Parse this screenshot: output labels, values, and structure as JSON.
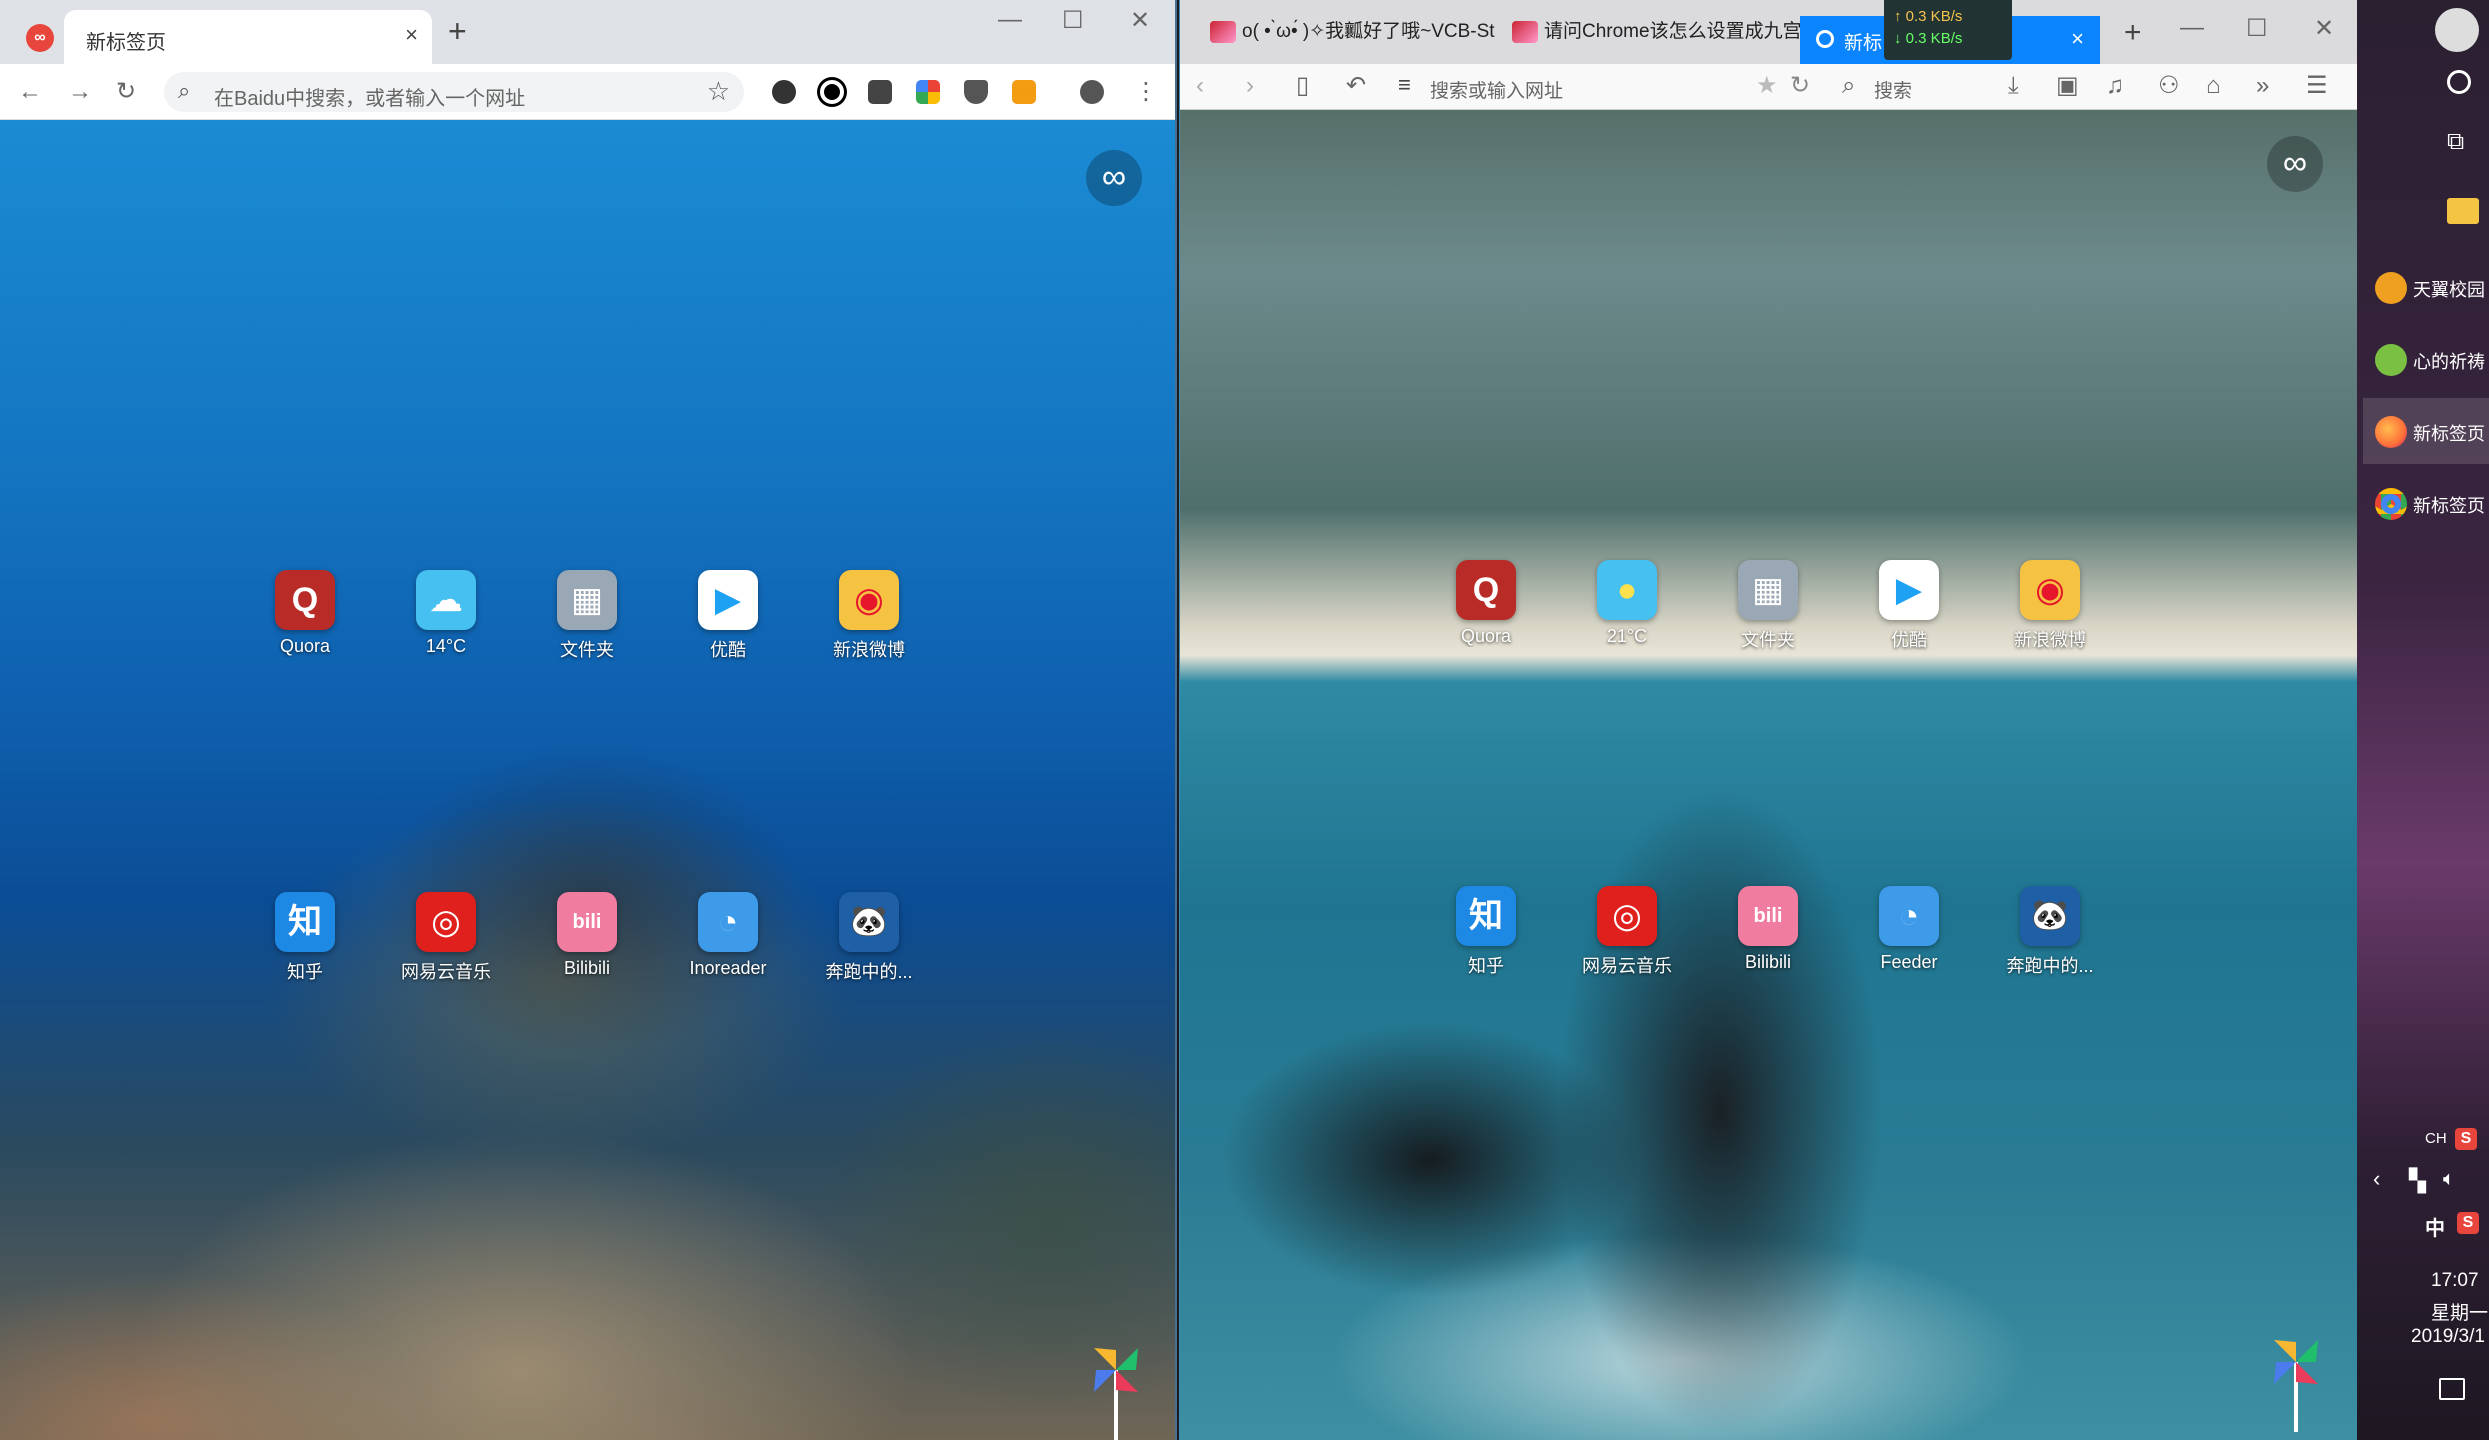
{
  "left_window": {
    "tab_title": "新标签页",
    "tab_close": "×",
    "new_tab": "+",
    "omnibox_placeholder": "在Baidu中搜索，或者输入一个网址",
    "window_controls": [
      "—",
      "☐",
      "✕"
    ],
    "shortcuts_row1": [
      {
        "label": "Quora",
        "glyph": "Q",
        "color": "#b92b27"
      },
      {
        "label": "14°C",
        "glyph": "☁",
        "color": "#46c0f0"
      },
      {
        "label": "文件夹",
        "glyph": "▦",
        "color": "#9aa7b4"
      },
      {
        "label": "优酷",
        "glyph": "▶",
        "color": "#ffffff"
      },
      {
        "label": "新浪微博",
        "glyph": "◉",
        "color": "#f5c242"
      }
    ],
    "shortcuts_row2": [
      {
        "label": "知乎",
        "glyph": "知",
        "color": "#1e88e5"
      },
      {
        "label": "网易云音乐",
        "glyph": "◎",
        "color": "#e0201c"
      },
      {
        "label": "Bilibili",
        "glyph": "bili",
        "color": "#f07ca0"
      },
      {
        "label": "Inoreader",
        "glyph": "◔",
        "color": "#3d9be9"
      },
      {
        "label": "奔跑中的...",
        "glyph": "🐼",
        "color": "#1f5fa6"
      }
    ],
    "infinity": "∞"
  },
  "right_window": {
    "tabs": [
      "o( • ̀ω•́ )✧我瓤好了哦~VCB-St",
      "请问Chrome该怎么设置成九宫"
    ],
    "active_tab_title": "新标",
    "net_up": "↑ 0.3 KB/s",
    "net_down": "↓ 0.3 KB/s",
    "new_tab": "+",
    "window_controls": [
      "—",
      "☐",
      "✕"
    ],
    "url_placeholder": "搜索或输入网址",
    "search_placeholder": "搜索",
    "shortcuts_row1": [
      {
        "label": "Quora",
        "glyph": "Q",
        "color": "#b92b27"
      },
      {
        "label": "21°C",
        "glyph": "●",
        "color": "#46c0f0"
      },
      {
        "label": "文件夹",
        "glyph": "▦",
        "color": "#9aa7b4"
      },
      {
        "label": "优酷",
        "glyph": "▶",
        "color": "#ffffff"
      },
      {
        "label": "新浪微博",
        "glyph": "◉",
        "color": "#f5c242"
      }
    ],
    "shortcuts_row2": [
      {
        "label": "知乎",
        "glyph": "知",
        "color": "#1e88e5"
      },
      {
        "label": "网易云音乐",
        "glyph": "◎",
        "color": "#e0201c"
      },
      {
        "label": "Bilibili",
        "glyph": "bili",
        "color": "#f07ca0"
      },
      {
        "label": "Feeder",
        "glyph": "◔",
        "color": "#3d9be9"
      },
      {
        "label": "奔跑中的...",
        "glyph": "🐼",
        "color": "#1f5fa6"
      }
    ],
    "infinity": "∞"
  },
  "taskbar": {
    "items": [
      {
        "label": "天翼校园",
        "color": "#f0a020"
      },
      {
        "label": "心的祈祷",
        "color": "#7ac043"
      },
      {
        "label": "新标签页",
        "color": "#ff7139"
      },
      {
        "label": "新标签页",
        "color": "#4285f4"
      }
    ],
    "ime_lang": "CH",
    "ime_mode": "中",
    "time": "17:07",
    "weekday": "星期一",
    "date": "2019/3/1"
  }
}
